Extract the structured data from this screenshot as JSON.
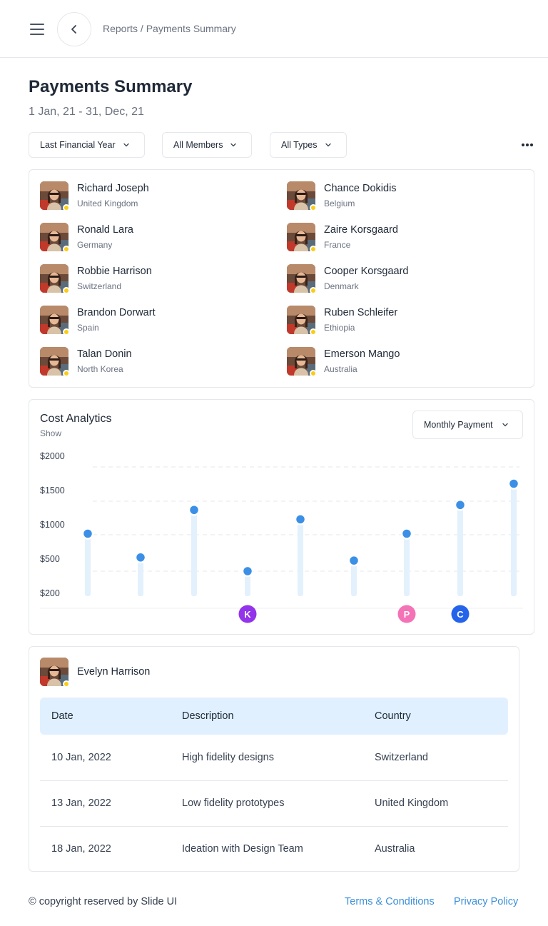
{
  "header": {
    "breadcrumb": "Reports / Payments Summary",
    "menu_icon": "hamburger-menu-icon",
    "back_icon": "chevron-left-icon"
  },
  "page": {
    "title": "Payments Summary",
    "date_range": "1 Jan, 21 - 31, Dec, 21"
  },
  "filters": [
    {
      "label": "Last Financial Year"
    },
    {
      "label": "All Members"
    },
    {
      "label": "All Types"
    }
  ],
  "more_icon": "more-horizontal-icon",
  "members": [
    {
      "name": "Richard Joseph",
      "country": "United Kingdom"
    },
    {
      "name": "Chance Dokidis",
      "country": "Belgium"
    },
    {
      "name": "Ronald Lara",
      "country": "Germany"
    },
    {
      "name": "Zaire Korsgaard",
      "country": "France"
    },
    {
      "name": "Robbie Harrison",
      "country": "Switzerland"
    },
    {
      "name": "Cooper Korsgaard",
      "country": "Denmark"
    },
    {
      "name": "Brandon Dorwart",
      "country": "Spain"
    },
    {
      "name": "Ruben Schleifer",
      "country": "Ethiopia"
    },
    {
      "name": "Talan Donin",
      "country": "North Korea"
    },
    {
      "name": "Emerson Mango",
      "country": "Australia"
    }
  ],
  "cost_analytics": {
    "title": "Cost Analytics",
    "subtitle": "Show",
    "dropdown_label": "Monthly Payment"
  },
  "chart_data": {
    "type": "scatter",
    "y_ticks": [
      "$2000",
      "$1500",
      "$1000",
      "$500",
      "$200"
    ],
    "ylim": [
      0,
      2000
    ],
    "grid": true,
    "x_markers": [
      {
        "kind": "photo"
      },
      {
        "kind": "photo"
      },
      {
        "kind": "photo"
      },
      {
        "kind": "letter",
        "letter": "K",
        "color": "#9333ea"
      },
      {
        "kind": "photo"
      },
      {
        "kind": "photo"
      },
      {
        "kind": "letter",
        "letter": "P",
        "color": "#f472b6"
      },
      {
        "kind": "letter",
        "letter": "C",
        "color": "#2563eb"
      },
      {
        "kind": "photo"
      }
    ],
    "values": [
      1000,
      620,
      1380,
      400,
      1230,
      570,
      1000,
      1460,
      1800
    ],
    "point_color": "#3b8fe6",
    "stem_color": "#e3f1fd"
  },
  "payments": {
    "person": "Evelyn Harrison",
    "columns": [
      "Date",
      "Description",
      "Country"
    ],
    "rows": [
      [
        "10 Jan, 2022",
        "High fidelity designs",
        "Switzerland"
      ],
      [
        "13 Jan, 2022",
        "Low fidelity prototypes",
        "United Kingdom"
      ],
      [
        "18 Jan, 2022",
        "Ideation with Design Team",
        "Australia"
      ]
    ]
  },
  "footer": {
    "copyright": "© copyright reserved by Slide UI",
    "terms": "Terms & Conditions",
    "privacy": "Privacy Policy"
  },
  "colors": {
    "accent": "#3b8fd8",
    "status_dot": "#facc15",
    "table_header_bg": "#e0f0fe"
  }
}
